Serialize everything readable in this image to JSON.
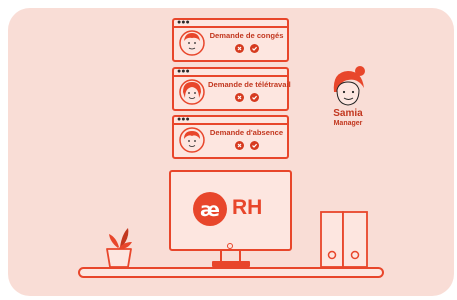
{
  "requests": [
    {
      "title": "Demande de congés",
      "reject_icon": "close-icon",
      "approve_icon": "check-icon"
    },
    {
      "title": "Demande de télétravail",
      "reject_icon": "close-icon",
      "approve_icon": "check-icon"
    },
    {
      "title": "Demande d'absence",
      "reject_icon": "close-icon",
      "approve_icon": "check-icon"
    }
  ],
  "manager": {
    "name": "Samia",
    "role": "Manager"
  },
  "logo": {
    "mark": "æ",
    "text": "RH"
  },
  "colors": {
    "accent": "#e8462b",
    "background": "#f9ddd6",
    "panel": "#fde6e0",
    "text": "#c2371f"
  }
}
